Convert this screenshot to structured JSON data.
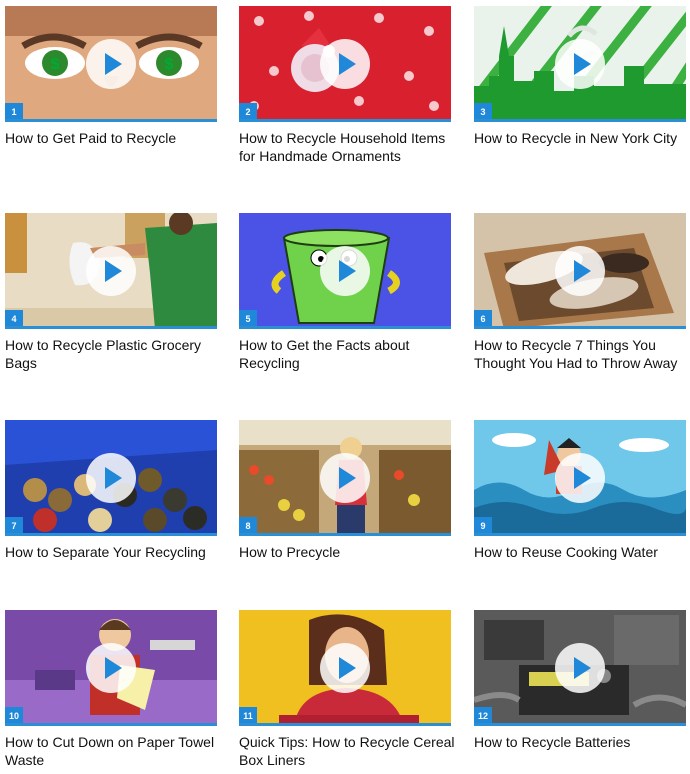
{
  "videos": [
    {
      "number": "1",
      "title": "How to Get Paid to Recycle"
    },
    {
      "number": "2",
      "title": "How to Recycle Household Items for Handmade Ornaments"
    },
    {
      "number": "3",
      "title": "How to Recycle in New York City"
    },
    {
      "number": "4",
      "title": "How to Recycle Plastic Grocery Bags"
    },
    {
      "number": "5",
      "title": "How to Get the Facts about Recycling"
    },
    {
      "number": "6",
      "title": "How to Recycle 7 Things You Thought You Had to Throw Away"
    },
    {
      "number": "7",
      "title": "How to Separate Your Recycling"
    },
    {
      "number": "8",
      "title": "How to Precycle"
    },
    {
      "number": "9",
      "title": "How to Reuse Cooking Water"
    },
    {
      "number": "10",
      "title": "How to Cut Down on Paper Towel Waste"
    },
    {
      "number": "11",
      "title": "Quick Tips: How to Recycle Cereal Box Liners"
    },
    {
      "number": "12",
      "title": "How to Recycle Batteries"
    }
  ],
  "icons": {
    "play": "play-icon"
  },
  "colors": {
    "accent": "#1f88d8"
  }
}
